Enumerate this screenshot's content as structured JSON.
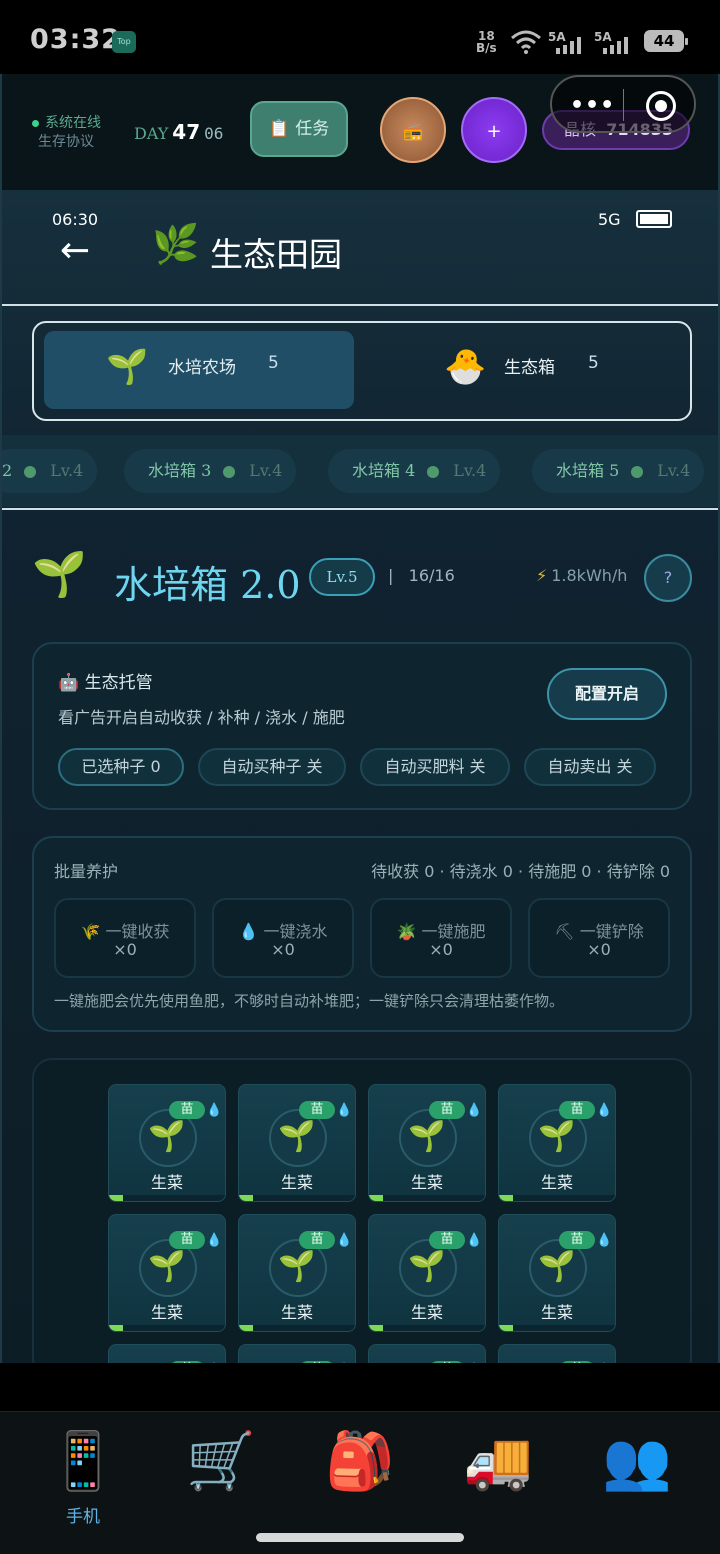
{
  "status_bar": {
    "time": "03:32",
    "badge": "Top",
    "net_speed": "18",
    "net_unit": "B/s",
    "sig1": "5A",
    "sig2": "5A",
    "battery": "44"
  },
  "app_bar": {
    "online_label": "系统在线",
    "protocol": "生存协议",
    "day_label": "DAY",
    "day_num": "47",
    "day_sub": "06",
    "task_icon": "📋",
    "task_label": "任务",
    "radio_icon": "📻",
    "plus_icon": "+",
    "crystal_label": "晶核",
    "crystal_value": "714835"
  },
  "miniprogram": {
    "more": "•••",
    "close_icon": "record-circle-icon"
  },
  "phone": {
    "time": "06:30",
    "network": "5G",
    "back_icon": "←",
    "title_icon": "🌿",
    "title": "生态田园"
  },
  "segment": [
    {
      "icon": "🌱",
      "label": "水培农场",
      "count": "5"
    },
    {
      "icon": "🐣",
      "label": "生态箱",
      "count": "5"
    }
  ],
  "box_tabs": [
    {
      "name": "2",
      "level": "Lv.4"
    },
    {
      "name": "水培箱 3",
      "level": "Lv.4"
    },
    {
      "name": "水培箱 4",
      "level": "Lv.4"
    },
    {
      "name": "水培箱 5",
      "level": "Lv.4"
    }
  ],
  "box": {
    "icon": "🌱",
    "title": "水培箱 2.0",
    "level": "Lv.5",
    "separator": "|",
    "slots": "16/16",
    "power_icon": "⚡",
    "power": "1.8kWh/h",
    "help": "?"
  },
  "hosting": {
    "icon": "🤖",
    "title": "生态托管",
    "desc": "看广告开启自动收获 / 补种 / 浇水 / 施肥",
    "config_button": "配置开启",
    "pills": [
      "已选种子 0",
      "自动买种子 关",
      "自动买肥料 关",
      "自动卖出 关"
    ]
  },
  "bulk": {
    "title": "批量养护",
    "stats": "待收获 0 · 待浇水 0 · 待施肥 0 · 待铲除 0",
    "actions": [
      {
        "icon": "🌾",
        "label": "一键收获",
        "count": "×0"
      },
      {
        "icon": "💧",
        "label": "一键浇水",
        "count": "×0"
      },
      {
        "icon": "🪴",
        "label": "一键施肥",
        "count": "×0"
      },
      {
        "icon": "⛏",
        "label": "一键铲除",
        "count": "×0"
      }
    ],
    "note": "一键施肥会优先使用鱼肥，不够时自动补堆肥；一键铲除只会清理枯萎作物。"
  },
  "plots": {
    "stage": "苗",
    "water_icon": "💧",
    "plant_icon": "🌱",
    "crop": "生菜",
    "growth_progress": 0.12
  },
  "bottom_nav": [
    {
      "icon": "📱",
      "label": "手机",
      "active": true
    },
    {
      "icon": "🛒",
      "label": ""
    },
    {
      "icon": "🎒",
      "label": ""
    },
    {
      "icon": "🚚",
      "label": ""
    },
    {
      "icon": "👥",
      "label": ""
    }
  ]
}
